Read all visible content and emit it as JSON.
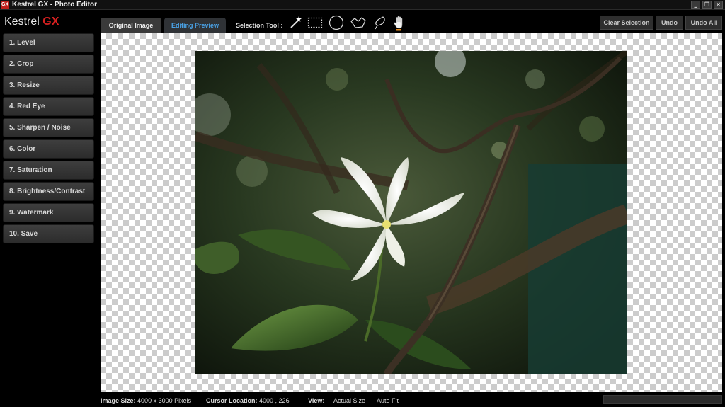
{
  "window": {
    "icon_text": "GX",
    "title": "Kestrel GX - Photo Editor",
    "controls": [
      "_",
      "❐",
      "✕"
    ]
  },
  "logo": {
    "main": "Kestrel ",
    "accent": "GX",
    "accent_color": "#d62020"
  },
  "menu": [
    {
      "label": "1. Level"
    },
    {
      "label": "2. Crop"
    },
    {
      "label": "3. Resize"
    },
    {
      "label": "4. Red Eye"
    },
    {
      "label": "5. Sharpen / Noise"
    },
    {
      "label": "6. Color"
    },
    {
      "label": "7. Saturation"
    },
    {
      "label": "8. Brightness/Contrast"
    },
    {
      "label": "9. Watermark"
    },
    {
      "label": "10. Save"
    }
  ],
  "tabs": {
    "original": "Original Image",
    "preview": "Editing Preview",
    "active": "preview",
    "active_color": "#4aa3e8"
  },
  "selection_tool": {
    "label": "Selection Tool :",
    "tools": [
      "magic-wand-icon",
      "rectangle-select-icon",
      "ellipse-select-icon",
      "polygon-lasso-icon",
      "freehand-lasso-icon",
      "hand-pan-icon"
    ]
  },
  "actions": {
    "clear_selection": "Clear Selection",
    "undo": "Undo",
    "undo_all": "Undo All"
  },
  "status": {
    "image_size_label": "Image Size:",
    "image_size_value": "4000 x 3000 Pixels",
    "cursor_label": "Cursor Location:",
    "cursor_value": "4000 , 226",
    "view_label": "View:",
    "view_actual": "Actual Size",
    "view_autofit": "Auto Fit"
  },
  "progress": {
    "value": 0
  }
}
